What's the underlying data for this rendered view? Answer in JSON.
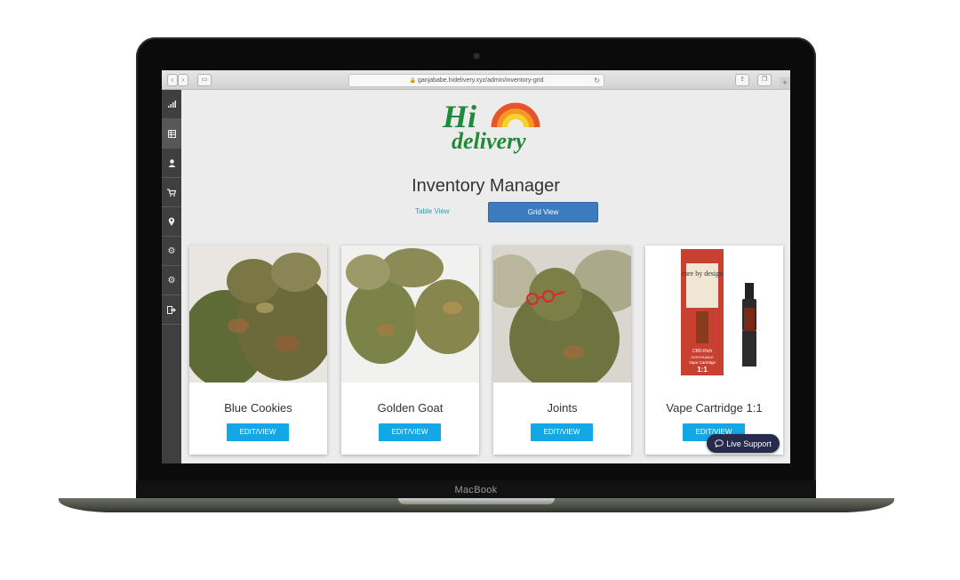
{
  "device": {
    "brand_label": "MacBook"
  },
  "browser": {
    "url": "ganjababe.hidelivery.xyz/admin/inventory-grid",
    "icons": [
      "back-icon",
      "forward-icon",
      "sidebar-toggle-icon",
      "lock-icon",
      "reload-icon",
      "share-icon",
      "tabs-icon",
      "new-tab-icon"
    ]
  },
  "sidebar": {
    "items": [
      {
        "icon": "stats-icon",
        "glyph": "▂▄▆"
      },
      {
        "icon": "inventory-icon",
        "glyph": "▤"
      },
      {
        "icon": "user-icon",
        "glyph": "👤"
      },
      {
        "icon": "cart-icon",
        "glyph": "🛒"
      },
      {
        "icon": "location-icon",
        "glyph": "⚲"
      },
      {
        "icon": "settings-icon",
        "glyph": "⚙"
      },
      {
        "icon": "settings-alt-icon",
        "glyph": "⚙"
      },
      {
        "icon": "logout-icon",
        "glyph": "⇥"
      }
    ]
  },
  "brand": {
    "logo_line1": "Hi",
    "logo_line2": "delivery"
  },
  "page": {
    "title": "Inventory Manager",
    "table_view_label": "Table View",
    "grid_view_label": "Grid View"
  },
  "products": [
    {
      "name": "Blue Cookies",
      "button": "EDIT/VIEW"
    },
    {
      "name": "Golden Goat",
      "button": "EDIT/VIEW"
    },
    {
      "name": "Joints",
      "button": "EDIT/VIEW"
    },
    {
      "name": "Vape Cartridge 1:1",
      "button": "EDIT/VIEW"
    }
  ],
  "vape_box": {
    "brand": "care by design",
    "line1": "CBD-Rich",
    "line2": "DISPOSABLE",
    "line3": "Vape Cartridge",
    "ratio": "1:1"
  },
  "support": {
    "label": "Live Support"
  },
  "colors": {
    "primary_button": "#3d7bbf",
    "edit_button": "#13a7e6",
    "sidebar": "#3f3f3f",
    "logo_green": "#1f8a3a",
    "support_bg": "#262a4d"
  }
}
